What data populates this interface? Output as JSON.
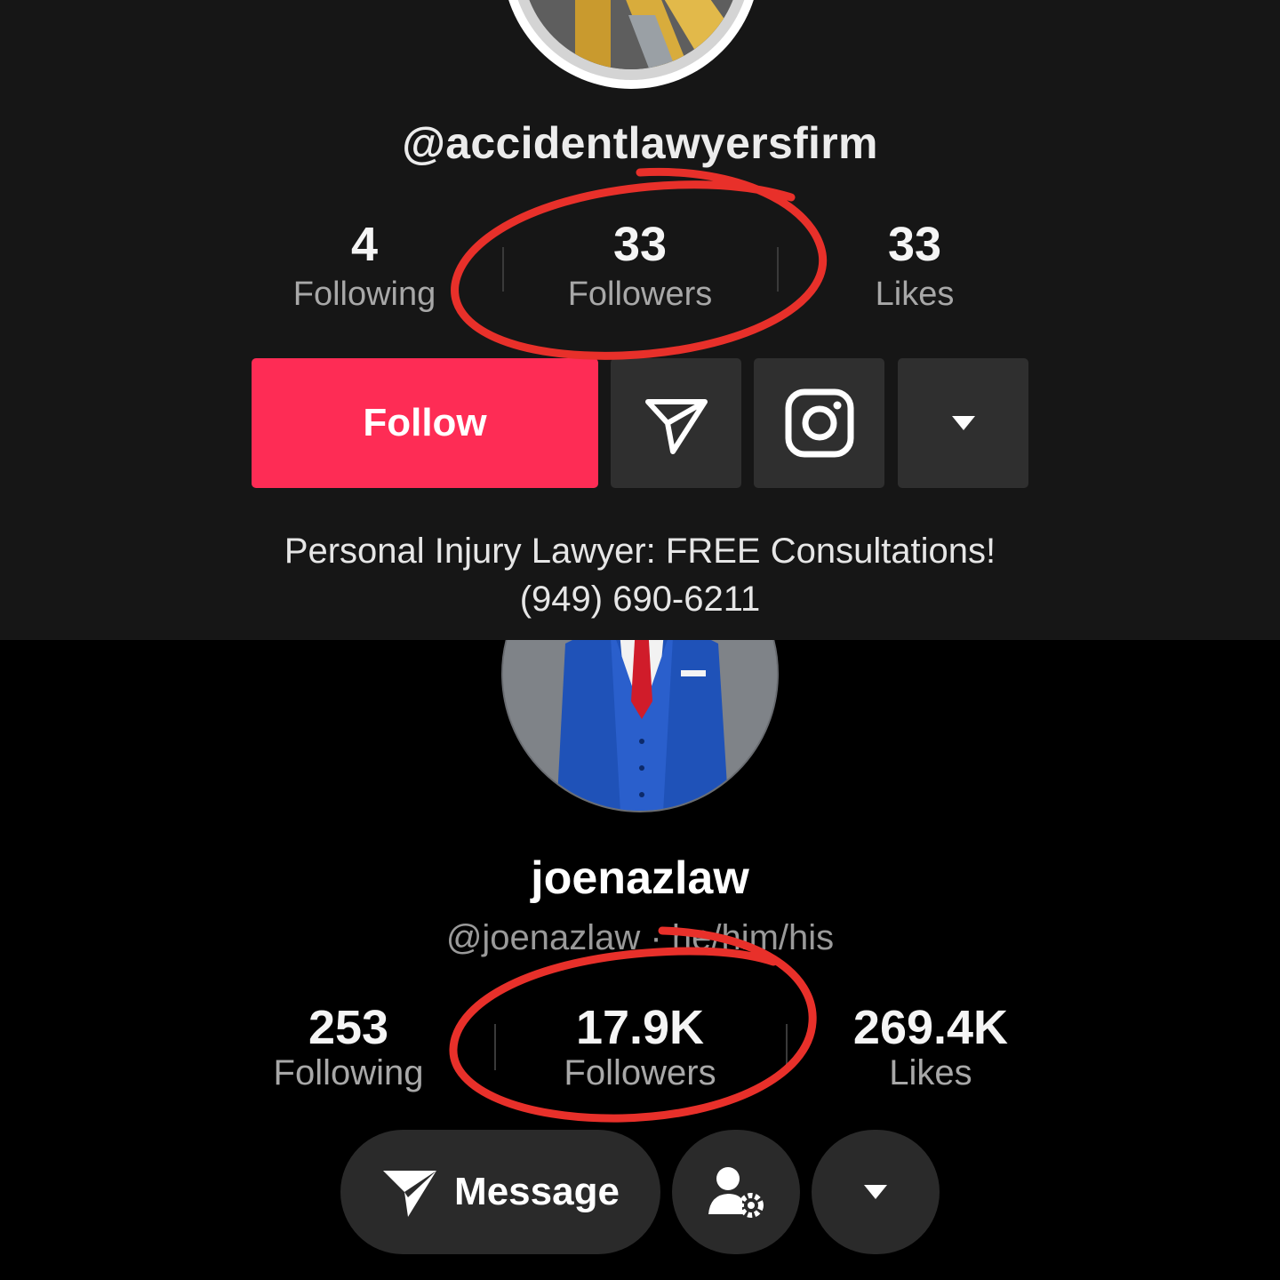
{
  "top_profile": {
    "handle": "@accidentlawyersfirm",
    "stats": [
      {
        "value": "4",
        "label": "Following"
      },
      {
        "value": "33",
        "label": "Followers"
      },
      {
        "value": "33",
        "label": "Likes"
      }
    ],
    "follow_label": "Follow",
    "actions": [
      "send-icon",
      "instagram-icon",
      "caret-down-icon"
    ],
    "bio_line1": "Personal Injury Lawyer: FREE Consultations!",
    "bio_line2": "(949) 690-6211",
    "accent_color": "#fe2c55"
  },
  "bottom_profile": {
    "display_name": "joenazlaw",
    "handle": "@joenazlaw · he/him/his",
    "stats": [
      {
        "value": "253",
        "label": "Following"
      },
      {
        "value": "17.9K",
        "label": "Followers"
      },
      {
        "value": "269.4K",
        "label": "Likes"
      }
    ],
    "message_label": "Message",
    "actions": [
      "send-icon",
      "user-settings-icon",
      "caret-down-icon"
    ]
  },
  "annotation_color": "#e8302a"
}
